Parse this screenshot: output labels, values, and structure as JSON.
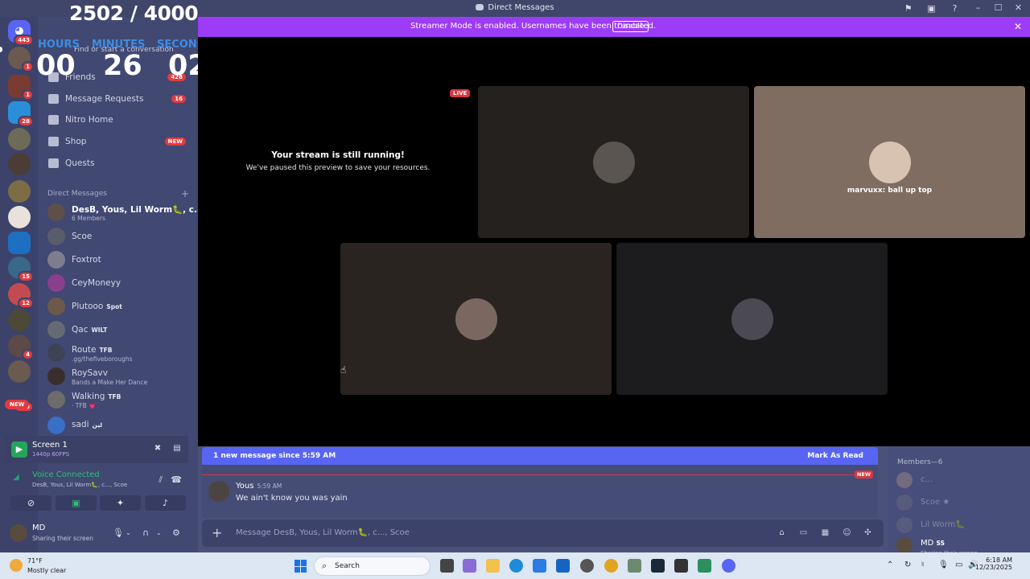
{
  "window": {
    "title": "Direct Messages",
    "title_icon": "discord-icon",
    "toolbar_icons": [
      "inbox-icon",
      "screen-icon",
      "help-icon"
    ],
    "controls": [
      "minimize-icon",
      "maximize-icon",
      "close-icon"
    ]
  },
  "banner": {
    "message": "Streamer Mode is enabled. Usernames have been truncated.",
    "button": "Disable",
    "close": "✕",
    "color": "#9c3cf6"
  },
  "overlay": {
    "counter": "2502 / 4000",
    "hours_label": "HOURS",
    "minutes_label": "MINUTES",
    "seconds_label": "SECONDS",
    "hours": "00",
    "minutes": "26",
    "seconds": "02"
  },
  "servers": {
    "home_badge": "443",
    "badges": [
      "1",
      "1",
      "28",
      "15",
      "12",
      "4",
      "299"
    ],
    "new_label": "NEW"
  },
  "sidebar": {
    "search_placeholder": "Find or start a conversation",
    "friends_label": "Friends",
    "friends_count": "428",
    "items": [
      {
        "label": "Message Requests",
        "count": "16",
        "icon": "envelope-icon"
      },
      {
        "label": "Nitro Home",
        "icon": "nitro-icon"
      },
      {
        "label": "Shop",
        "badge": "NEW",
        "icon": "shop-icon"
      },
      {
        "label": "Quests",
        "icon": "quests-icon"
      }
    ],
    "dm_header": "Direct Messages",
    "dms": [
      {
        "name": "DesB, Yous, Lil Worm🐛, c...",
        "sub": "6 Members"
      },
      {
        "name": "Scoe"
      },
      {
        "name": "Foxtrot"
      },
      {
        "name": "CeyMoneyy"
      },
      {
        "name": "Plutooo",
        "tag": "Spot"
      },
      {
        "name": "Qac",
        "tag": "WILT"
      },
      {
        "name": "Route",
        "tag": "TFB",
        "sub": ".gg/thefiveboroughs"
      },
      {
        "name": "RoySavv",
        "sub": "Bands a Make Her Dance"
      },
      {
        "name": "Walking",
        "tag": "TFB",
        "sub": "· TFB 💗"
      },
      {
        "name": "sadi",
        "tag": "لين"
      }
    ]
  },
  "screen_panel": {
    "title": "Screen 1",
    "quality": "1440p 60FPS"
  },
  "voice": {
    "status": "Voice Connected",
    "channel": "DesB, Yous, Lil Worm🐛, c..., Scoe"
  },
  "user": {
    "name": "MD",
    "status": "Sharing their screen"
  },
  "stage": {
    "live": "LIVE",
    "paused_title": "Your stream is still running!",
    "paused_sub": "We've paused this preview to save your resources.",
    "caption": "marvuxx: ball up top"
  },
  "chat": {
    "new_banner": "1 new message since 5:59 AM",
    "mark_read": "Mark As Read",
    "new_tag": "NEW",
    "message": {
      "author": "Yous",
      "time": "5:59 AM",
      "text": "We ain't know you was yain"
    },
    "composer_placeholder": "Message DesB, Yous, Lil Worm🐛, c..., Scoe"
  },
  "members": {
    "header": "Members—6",
    "list": [
      {
        "name": "c..."
      },
      {
        "name": "Scoe ★"
      },
      {
        "name": "Lil Worm🐛"
      },
      {
        "name": "MD",
        "tag": "SS",
        "status": "Sharing their screen"
      }
    ]
  },
  "taskbar": {
    "temp": "71°F",
    "condition": "Mostly clear",
    "search": "Search",
    "time": "6:18 AM",
    "date": "12/23/2025"
  }
}
